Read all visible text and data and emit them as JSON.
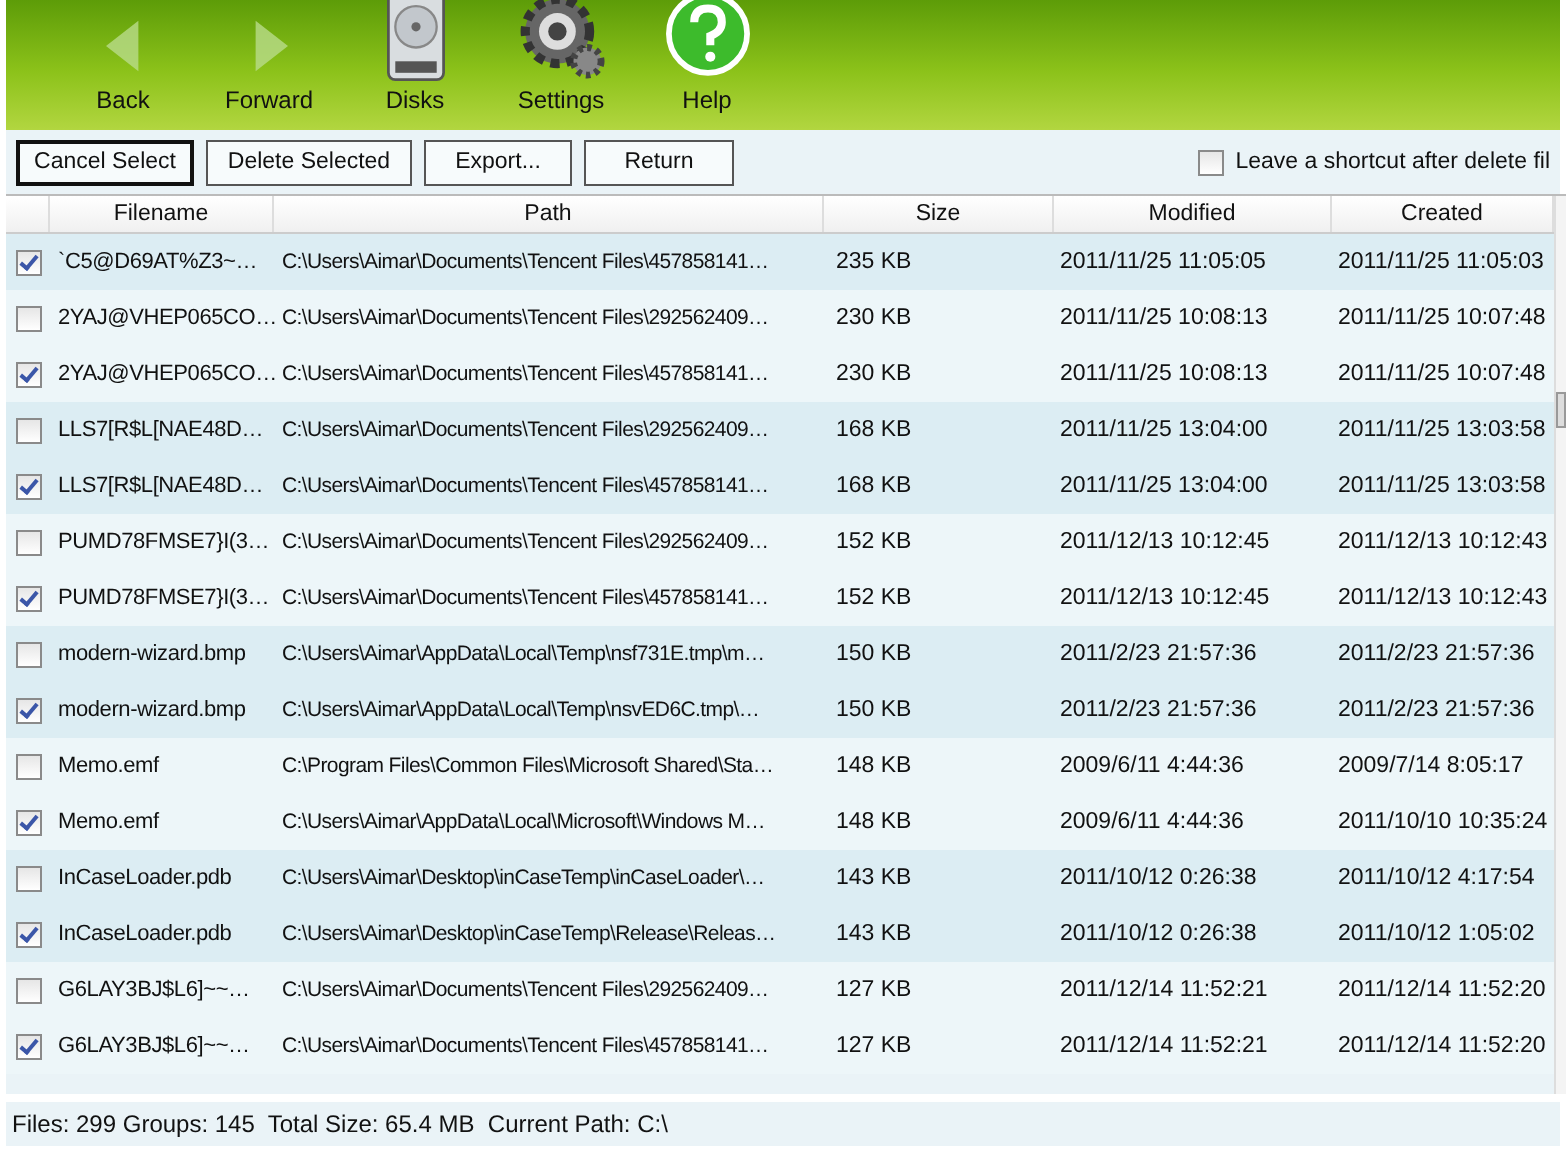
{
  "toolbar": [
    {
      "kind": "back",
      "label": "Back",
      "disabled": true
    },
    {
      "kind": "forward",
      "label": "Forward",
      "disabled": true
    },
    {
      "kind": "disks",
      "label": "Disks",
      "disabled": false
    },
    {
      "kind": "settings",
      "label": "Settings",
      "disabled": false
    },
    {
      "kind": "help",
      "label": "Help",
      "disabled": false
    }
  ],
  "actions": [
    {
      "label": "Cancel Select",
      "focused": true
    },
    {
      "label": "Delete Selected",
      "focused": false
    },
    {
      "label": "Export...",
      "focused": false
    },
    {
      "label": "Return",
      "focused": false
    }
  ],
  "shortcut_option": {
    "label": "Leave a shortcut after delete fil",
    "checked": false
  },
  "table": {
    "columns": [
      "Filename",
      "Path",
      "Size",
      "Modified",
      "Created"
    ],
    "rows": [
      {
        "checked": true,
        "shaded": true,
        "cells": [
          "`C5@D69AT%Z3~…",
          "C:\\Users\\Aimar\\Documents\\Tencent Files\\457858141…",
          "235 KB",
          "2011/11/25 11:05:05",
          "2011/11/25 11:05:03"
        ]
      },
      {
        "checked": false,
        "shaded": false,
        "cells": [
          "2YAJ@VHEP065CO…",
          "C:\\Users\\Aimar\\Documents\\Tencent Files\\292562409…",
          "230 KB",
          "2011/11/25 10:08:13",
          "2011/11/25 10:07:48"
        ]
      },
      {
        "checked": true,
        "shaded": false,
        "cells": [
          "2YAJ@VHEP065CO…",
          "C:\\Users\\Aimar\\Documents\\Tencent Files\\457858141…",
          "230 KB",
          "2011/11/25 10:08:13",
          "2011/11/25 10:07:48"
        ]
      },
      {
        "checked": false,
        "shaded": true,
        "cells": [
          "LLS7[R$L[NAE48D…",
          "C:\\Users\\Aimar\\Documents\\Tencent Files\\292562409…",
          "168 KB",
          "2011/11/25 13:04:00",
          "2011/11/25 13:03:58"
        ]
      },
      {
        "checked": true,
        "shaded": true,
        "cells": [
          "LLS7[R$L[NAE48D…",
          "C:\\Users\\Aimar\\Documents\\Tencent Files\\457858141…",
          "168 KB",
          "2011/11/25 13:04:00",
          "2011/11/25 13:03:58"
        ]
      },
      {
        "checked": false,
        "shaded": false,
        "cells": [
          "PUMD78FMSE7}I(3…",
          "C:\\Users\\Aimar\\Documents\\Tencent Files\\292562409…",
          "152 KB",
          "2011/12/13 10:12:45",
          "2011/12/13 10:12:43"
        ]
      },
      {
        "checked": true,
        "shaded": false,
        "cells": [
          "PUMD78FMSE7}I(3…",
          "C:\\Users\\Aimar\\Documents\\Tencent Files\\457858141…",
          "152 KB",
          "2011/12/13 10:12:45",
          "2011/12/13 10:12:43"
        ]
      },
      {
        "checked": false,
        "shaded": true,
        "cells": [
          "modern-wizard.bmp",
          "C:\\Users\\Aimar\\AppData\\Local\\Temp\\nsf731E.tmp\\m…",
          "150 KB",
          "2011/2/23 21:57:36",
          "2011/2/23 21:57:36"
        ]
      },
      {
        "checked": true,
        "shaded": true,
        "cells": [
          "modern-wizard.bmp",
          "C:\\Users\\Aimar\\AppData\\Local\\Temp\\nsvED6C.tmp\\…",
          "150 KB",
          "2011/2/23 21:57:36",
          "2011/2/23 21:57:36"
        ]
      },
      {
        "checked": false,
        "shaded": false,
        "cells": [
          "Memo.emf",
          "C:\\Program Files\\Common Files\\Microsoft Shared\\Sta…",
          "148 KB",
          "2009/6/11 4:44:36",
          "2009/7/14 8:05:17"
        ]
      },
      {
        "checked": true,
        "shaded": false,
        "cells": [
          "Memo.emf",
          "C:\\Users\\Aimar\\AppData\\Local\\Microsoft\\Windows M…",
          "148 KB",
          "2009/6/11 4:44:36",
          "2011/10/10 10:35:24"
        ]
      },
      {
        "checked": false,
        "shaded": true,
        "cells": [
          "InCaseLoader.pdb",
          "C:\\Users\\Aimar\\Desktop\\inCaseTemp\\inCaseLoader\\…",
          "143 KB",
          "2011/10/12 0:26:38",
          "2011/10/12 4:17:54"
        ]
      },
      {
        "checked": true,
        "shaded": true,
        "cells": [
          "InCaseLoader.pdb",
          "C:\\Users\\Aimar\\Desktop\\inCaseTemp\\Release\\Releas…",
          "143 KB",
          "2011/10/12 0:26:38",
          "2011/10/12 1:05:02"
        ]
      },
      {
        "checked": false,
        "shaded": false,
        "cells": [
          "G6LAY3BJ$L6]~~…",
          "C:\\Users\\Aimar\\Documents\\Tencent Files\\292562409…",
          "127 KB",
          "2011/12/14 11:52:21",
          "2011/12/14 11:52:20"
        ]
      },
      {
        "checked": true,
        "shaded": false,
        "cells": [
          "G6LAY3BJ$L6]~~…",
          "C:\\Users\\Aimar\\Documents\\Tencent Files\\457858141…",
          "127 KB",
          "2011/12/14 11:52:21",
          "2011/12/14 11:52:20"
        ]
      }
    ]
  },
  "status_bar": "Files: 299 Groups: 145  Total Size: 65.4 MB  Current Path: C:\\"
}
